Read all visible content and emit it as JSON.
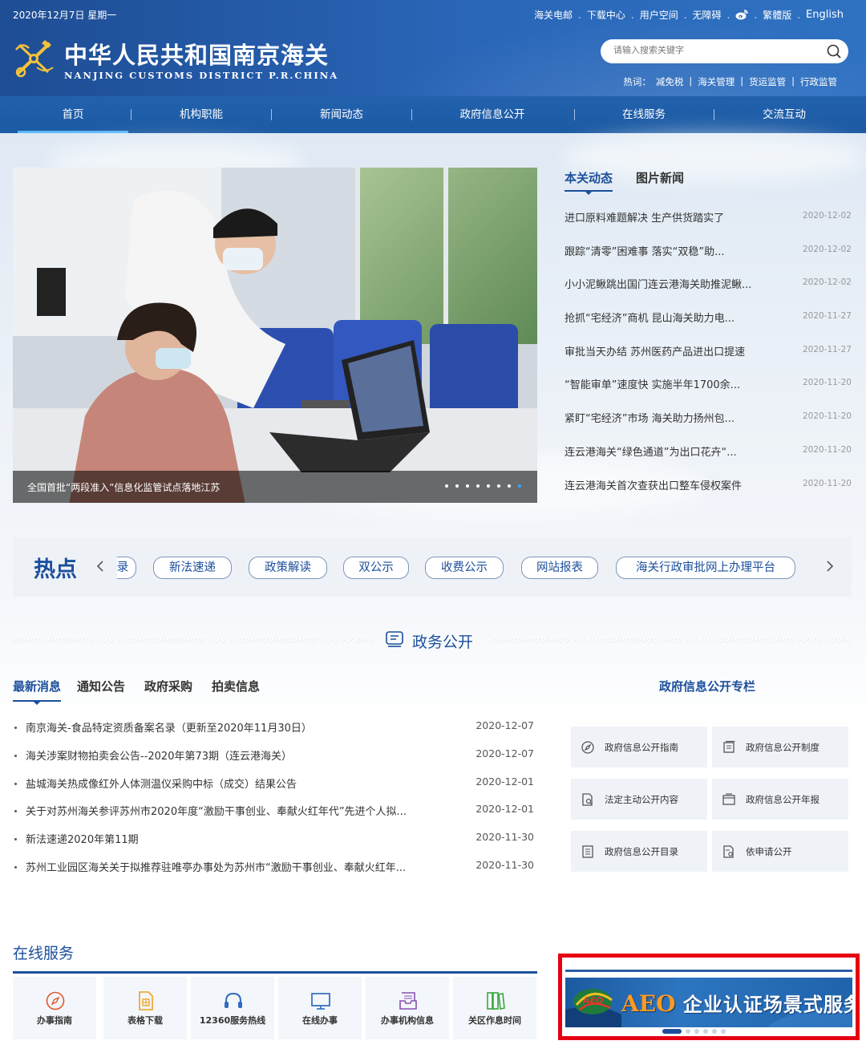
{
  "header": {
    "date": "2020年12月7日 星期一",
    "top_links": [
      "海关电邮",
      "下载中心",
      "用户空间",
      "无障碍",
      "繁體版",
      "English"
    ],
    "title_cn": "中华人民共和国南京海关",
    "title_en": "NANJING CUSTOMS DISTRICT P.R.CHINA",
    "search_placeholder": "请输入搜索关键字",
    "hot_label": "热词：",
    "hot_words": [
      "减免税",
      "海关管理",
      "货运监管",
      "行政监管"
    ]
  },
  "nav": {
    "items": [
      "首页",
      "机构职能",
      "新闻动态",
      "政府信息公开",
      "在线服务",
      "交流互动"
    ],
    "active": "首页"
  },
  "slider": {
    "caption": "全国首批“两段准入”信息化监管试点落地江苏",
    "dot_count": 8,
    "active_dot": 7
  },
  "news": {
    "tabs": [
      "本关动态",
      "图片新闻"
    ],
    "items": [
      {
        "title": "进口原料难题解决 生产供货踏实了",
        "date": "2020-12-02"
      },
      {
        "title": "跟踪“清零”困难事 落实“双稳”助...",
        "date": "2020-12-02"
      },
      {
        "title": "小小泥鳅跳出国门连云港海关助推泥鳅...",
        "date": "2020-12-02"
      },
      {
        "title": "抢抓“宅经济”商机 昆山海关助力电...",
        "date": "2020-11-27"
      },
      {
        "title": "审批当天办结 苏州医药产品进出口提速",
        "date": "2020-11-27"
      },
      {
        "title": "“智能审单”速度快 实施半年1700余...",
        "date": "2020-11-20"
      },
      {
        "title": "紧盯“宅经济”市场 海关助力扬州包...",
        "date": "2020-11-20"
      },
      {
        "title": "连云港海关“绿色通道”为出口花卉“...",
        "date": "2020-11-20"
      },
      {
        "title": "连云港海关首次查获出口整车侵权案件",
        "date": "2020-11-20"
      }
    ]
  },
  "hot": {
    "title": "热点",
    "tags": [
      "录",
      "新法速递",
      "政策解读",
      "双公示",
      "收费公示",
      "网站报表",
      "海关行政审批网上办理平台"
    ]
  },
  "gov": {
    "section_title": "政务公开",
    "tabs": [
      "最新消息",
      "通知公告",
      "政府采购",
      "拍卖信息"
    ],
    "items": [
      {
        "title": "南京海关-食品特定资质备案名录（更新至2020年11月30日）",
        "date": "2020-12-07"
      },
      {
        "title": "海关涉案财物拍卖会公告--2020年第73期（连云港海关）",
        "date": "2020-12-07"
      },
      {
        "title": "盐城海关热成像红外人体测温仪采购中标（成交）结果公告",
        "date": "2020-12-01"
      },
      {
        "title": "关于对苏州海关参评苏州市2020年度“激励干事创业、奉献火红年代”先进个人拟...",
        "date": "2020-12-01"
      },
      {
        "title": "新法速递2020年第11期",
        "date": "2020-11-30"
      },
      {
        "title": "苏州工业园区海关关于拟推荐驻唯亭办事处为苏州市“激励干事创业、奉献火红年...",
        "date": "2020-11-30"
      }
    ],
    "column_title": "政府信息公开专栏",
    "column_items": [
      {
        "label": "政府信息公开指南",
        "icon": "compass-icon"
      },
      {
        "label": "政府信息公开制度",
        "icon": "document-stack-icon"
      },
      {
        "label": "法定主动公开内容",
        "icon": "document-search-icon"
      },
      {
        "label": "政府信息公开年报",
        "icon": "folder-icon"
      },
      {
        "label": "政府信息公开目录",
        "icon": "list-icon"
      },
      {
        "label": "依申请公开",
        "icon": "request-form-icon"
      }
    ]
  },
  "services": {
    "title": "在线服务",
    "items": [
      {
        "label": "办事指南",
        "icon": "compass-icon"
      },
      {
        "label": "表格下载",
        "icon": "form-download-icon"
      },
      {
        "label": "12360服务热线",
        "icon": "headset-icon"
      },
      {
        "label": "在线办事",
        "icon": "monitor-icon"
      },
      {
        "label": "办事机构信息",
        "icon": "building-inbox-icon"
      },
      {
        "label": "关区作息时间",
        "icon": "books-icon"
      }
    ]
  },
  "aeo_banner": {
    "logo_text": "AEO",
    "main_word": "AEO",
    "text": "企业认证场景式服务",
    "dot_count": 6,
    "active_dot": 0
  },
  "colors": {
    "brand_blue": "#1c4f9c",
    "header_blue": "#2a66b8",
    "highlight_red": "#e60012"
  }
}
